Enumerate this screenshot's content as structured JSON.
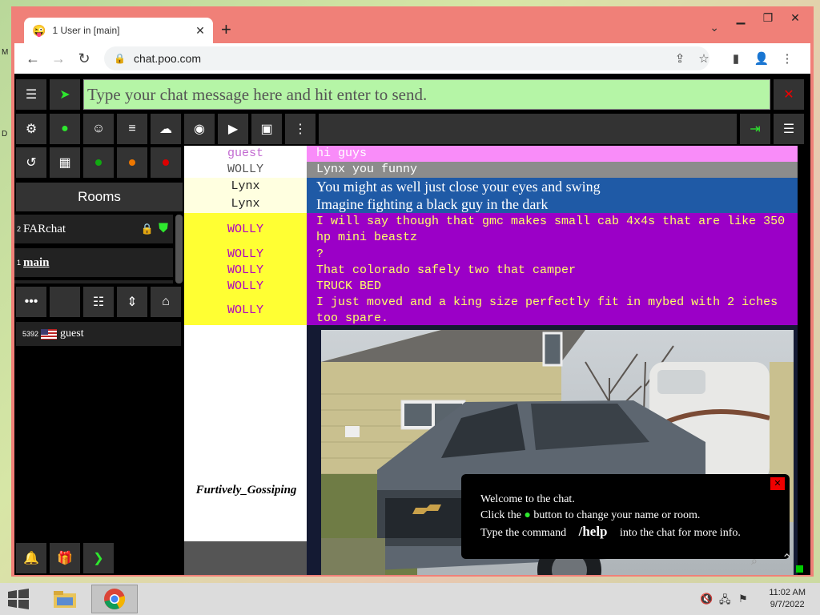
{
  "browser": {
    "tab_title": "1 User in [main]",
    "url": "chat.poo.com",
    "new_tab": "+",
    "tab_menu": "⌄"
  },
  "chat_input": {
    "placeholder": "Type your chat message here and hit enter to send."
  },
  "rooms": {
    "header": "Rooms",
    "items": [
      {
        "count": "2",
        "name": "FARchat"
      },
      {
        "count": "1",
        "name": "main"
      }
    ]
  },
  "users": [
    {
      "id": "5392",
      "name": "guest"
    }
  ],
  "messages": [
    {
      "user": "guest",
      "text": "hi guys"
    },
    {
      "user": "WOLLY",
      "text": "Lynx you funny"
    },
    {
      "user": "Lynx",
      "text": "You might as well just close your eyes and swing"
    },
    {
      "user": "Lynx",
      "text": "Imagine fighting a black guy in the dark"
    },
    {
      "user": "WOLLY",
      "text": "I will say though that gmc makes small cab 4x4s that are like 350 hp mini beastz"
    },
    {
      "user": "WOLLY",
      "text": "?"
    },
    {
      "user": "WOLLY",
      "text": "That colorado safely two that camper"
    },
    {
      "user": "WOLLY",
      "text": "TRUCK BED"
    },
    {
      "user": "WOLLY",
      "text": "I just moved and a king size perfectly fit in mybed with 2 iches too spare."
    }
  ],
  "image_caption": "Furtively_Gossiping",
  "welcome": {
    "line1": "Welcome to the chat.",
    "line2_a": "Click the",
    "line2_b": "button to change your name or room.",
    "line3_a": "Type the command",
    "command": "/help",
    "line3_b": "into the chat for more info."
  },
  "taskbar": {
    "time": "11:02 AM",
    "date": "9/7/2022"
  },
  "colors": {
    "window_frame": "#f08078",
    "input_bg": "#b5f5a6",
    "accent_green": "#2ee82e",
    "guest_row": "#f98cf9",
    "wolly_light_row": "#8c8c8c",
    "lynx_row": "#1f5aa6",
    "wolly_row": "#9b00c7",
    "wolly_name_bg": "#ffff33",
    "lynx_name_bg": "#ffffe0"
  }
}
